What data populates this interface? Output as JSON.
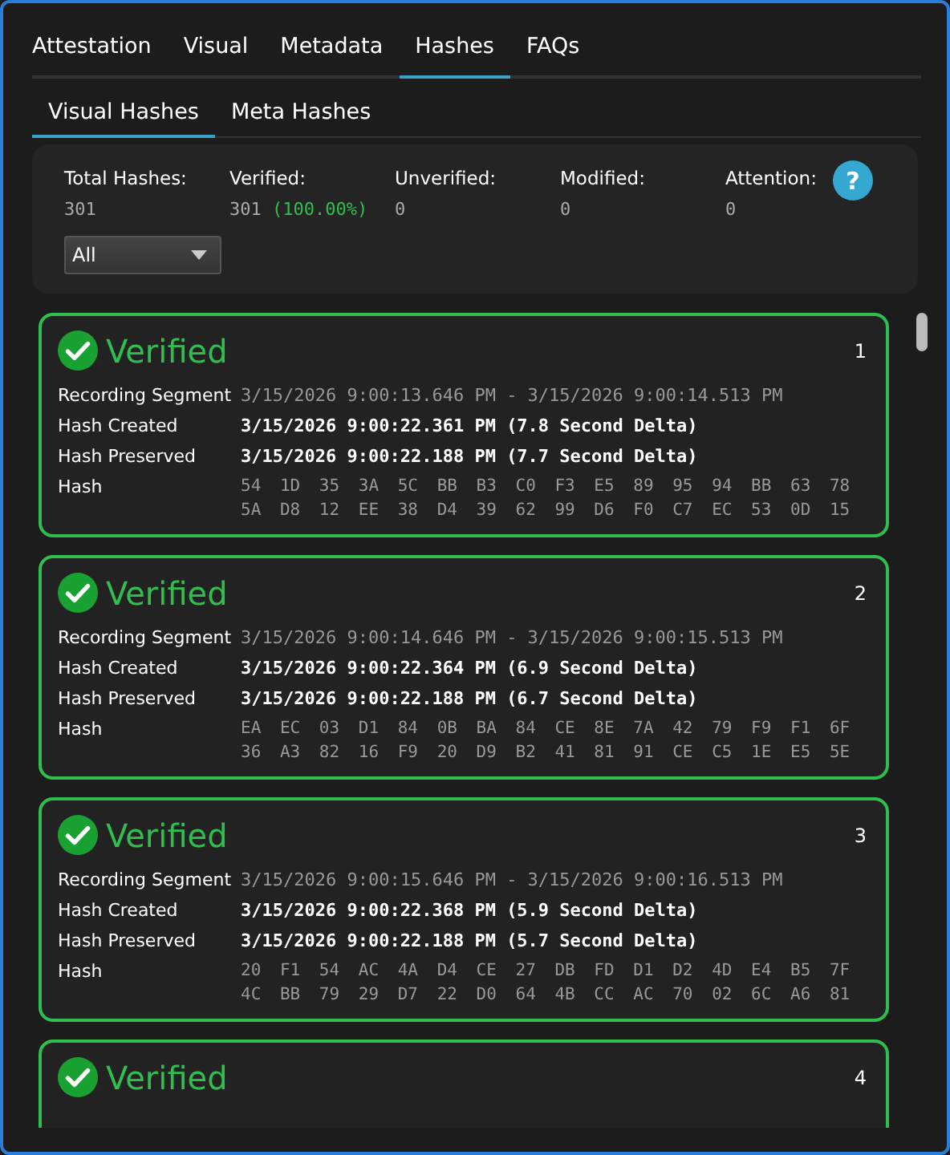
{
  "tabs": [
    {
      "label": "Attestation",
      "selected": false
    },
    {
      "label": "Visual",
      "selected": false
    },
    {
      "label": "Metadata",
      "selected": false
    },
    {
      "label": "Hashes",
      "selected": true
    },
    {
      "label": "FAQs",
      "selected": false
    }
  ],
  "subtabs": [
    {
      "label": "Visual Hashes",
      "selected": true
    },
    {
      "label": "Meta Hashes",
      "selected": false
    }
  ],
  "stats": [
    {
      "label": "Total Hashes:",
      "value": "301"
    },
    {
      "label": "Verified:",
      "value": "301",
      "percent": "(100.00%)"
    },
    {
      "label": "Unverified:",
      "value": "0"
    },
    {
      "label": "Modified:",
      "value": "0"
    },
    {
      "label": "Attention:",
      "value": "0"
    }
  ],
  "help": {
    "label": "?"
  },
  "filter": {
    "value": "All"
  },
  "records": [
    {
      "verified": true,
      "status": "Verified",
      "number": "1",
      "rows": [
        {
          "kind": "dim",
          "label": "Recording Segment",
          "value": "3/15/2026 9:00:13.646 PM - 3/15/2026 9:00:14.513 PM"
        },
        {
          "kind": "bright",
          "label": "Hash Created",
          "value": "3/15/2026 9:00:22.361 PM (7.8 Second Delta)"
        },
        {
          "kind": "bright",
          "label": "Hash Preserved",
          "value": "3/15/2026 9:00:22.188 PM (7.7 Second Delta)"
        },
        {
          "kind": "hash",
          "label": "Hash",
          "lines": [
            "54 1D 35 3A 5C BB B3 C0 F3 E5 89 95 94 BB 63 78",
            "5A D8 12 EE 38 D4 39 62 99 D6 F0 C7 EC 53 0D 15"
          ]
        }
      ]
    },
    {
      "verified": true,
      "status": "Verified",
      "number": "2",
      "rows": [
        {
          "kind": "dim",
          "label": "Recording Segment",
          "value": "3/15/2026 9:00:14.646 PM - 3/15/2026 9:00:15.513 PM"
        },
        {
          "kind": "bright",
          "label": "Hash Created",
          "value": "3/15/2026 9:00:22.364 PM (6.9 Second Delta)"
        },
        {
          "kind": "bright",
          "label": "Hash Preserved",
          "value": "3/15/2026 9:00:22.188 PM (6.7 Second Delta)"
        },
        {
          "kind": "hash",
          "label": "Hash",
          "lines": [
            "EA EC 03 D1 84 0B BA 84 CE 8E 7A 42 79 F9 F1 6F",
            "36 A3 82 16 F9 20 D9 B2 41 81 91 CE C5 1E E5 5E"
          ]
        }
      ]
    },
    {
      "verified": true,
      "status": "Verified",
      "number": "3",
      "rows": [
        {
          "kind": "dim",
          "label": "Recording Segment",
          "value": "3/15/2026 9:00:15.646 PM - 3/15/2026 9:00:16.513 PM"
        },
        {
          "kind": "bright",
          "label": "Hash Created",
          "value": "3/15/2026 9:00:22.368 PM (5.9 Second Delta)"
        },
        {
          "kind": "bright",
          "label": "Hash Preserved",
          "value": "3/15/2026 9:00:22.188 PM (5.7 Second Delta)"
        },
        {
          "kind": "hash",
          "label": "Hash",
          "lines": [
            "20 F1 54 AC 4A D4 CE 27 DB FD D1 D2 4D E4 B5 7F",
            "4C BB 79 29 D7 22 D0 64 4B CC AC 70 02 6C A6 81"
          ]
        }
      ]
    },
    {
      "verified": true,
      "status": "Verified",
      "number": "4"
    }
  ]
}
